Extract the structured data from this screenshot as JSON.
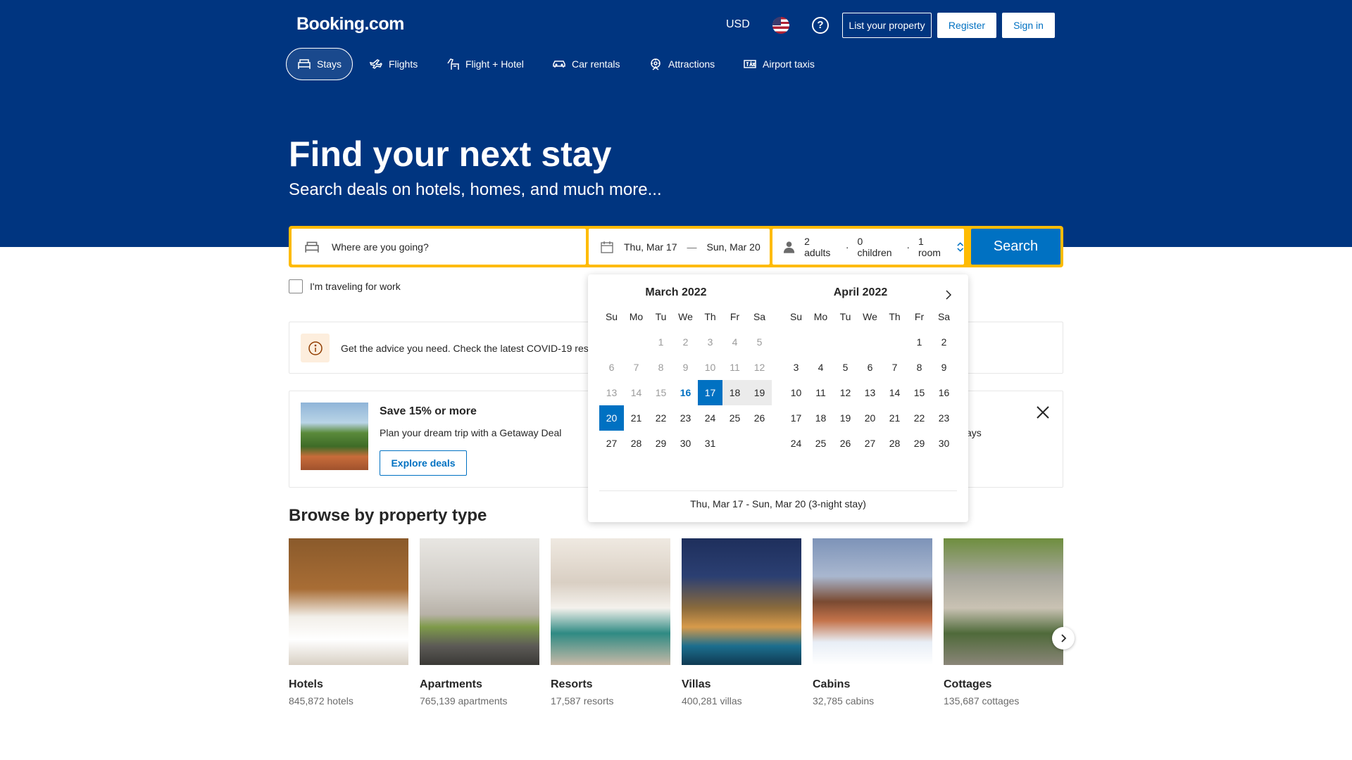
{
  "header": {
    "logo": "Booking.com",
    "currency": "USD",
    "list_property": "List your property",
    "register": "Register",
    "sign_in": "Sign in",
    "flag_icon": "us-flag-icon",
    "help_icon": "help-icon"
  },
  "nav": [
    {
      "label": "Stays",
      "icon": "bed-icon",
      "active": true
    },
    {
      "label": "Flights",
      "icon": "plane-icon"
    },
    {
      "label": "Flight + Hotel",
      "icon": "flight-hotel-icon"
    },
    {
      "label": "Car rentals",
      "icon": "car-icon"
    },
    {
      "label": "Attractions",
      "icon": "attractions-icon"
    },
    {
      "label": "Airport taxis",
      "icon": "taxi-icon"
    }
  ],
  "hero": {
    "title": "Find your next stay",
    "subtitle": "Search deals on hotels, homes, and much more..."
  },
  "search": {
    "destination_placeholder": "Where are you going?",
    "checkin": "Thu, Mar 17",
    "dash": "—",
    "checkout": "Sun, Mar 20",
    "adults": "2 adults",
    "children": "0 children",
    "rooms": "1 room",
    "dot": "·",
    "button": "Search"
  },
  "work_travel_label": "I'm traveling for work",
  "advice": {
    "text": "Get the advice you need. Check the latest COVID-19 res"
  },
  "promo": {
    "title": "Save 15% or more",
    "text": "Plan your dream trip with a Getaway Deal",
    "button": "Explore deals",
    "fragment": "ays"
  },
  "calendar": {
    "months": [
      {
        "name": "March 2022",
        "offset": 2,
        "days": 31
      },
      {
        "name": "April 2022",
        "offset": 5,
        "days": 30
      }
    ],
    "weekdays": [
      "Su",
      "Mo",
      "Tu",
      "We",
      "Th",
      "Fr",
      "Sa"
    ],
    "footer": "Thu, Mar 17 - Sun, Mar 20 (3-night stay)"
  },
  "browse": {
    "title": "Browse by property type",
    "types": [
      {
        "name": "Hotels",
        "count": "845,872 hotels"
      },
      {
        "name": "Apartments",
        "count": "765,139 apartments"
      },
      {
        "name": "Resorts",
        "count": "17,587 resorts"
      },
      {
        "name": "Villas",
        "count": "400,281 villas"
      },
      {
        "name": "Cabins",
        "count": "32,785 cabins"
      },
      {
        "name": "Cottages",
        "count": "135,687 cottages"
      }
    ]
  },
  "colors": {
    "brand_blue": "#003580",
    "accent_blue": "#0071c2",
    "search_border": "#febb02"
  }
}
